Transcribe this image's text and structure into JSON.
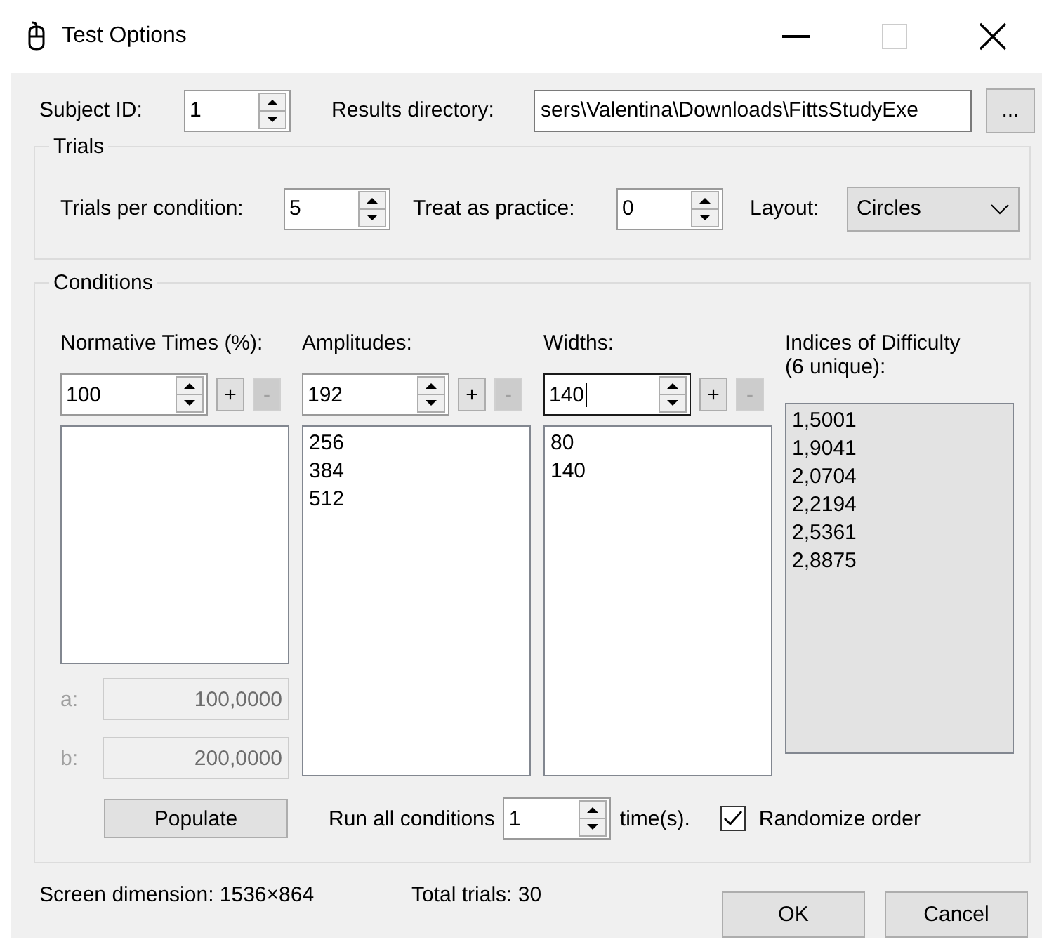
{
  "window": {
    "title": "Test Options"
  },
  "subject_id": {
    "label": "Subject ID:",
    "value": "1"
  },
  "results_directory": {
    "label": "Results directory:",
    "value": "sers\\Valentina\\Downloads\\FittsStudyExe"
  },
  "browse_button": {
    "label": "..."
  },
  "trials": {
    "title": "Trials",
    "trials_per_condition": {
      "label": "Trials per condition:",
      "value": "5"
    },
    "treat_as_practice": {
      "label": "Treat as practice:",
      "value": "0"
    },
    "layout": {
      "label": "Layout:",
      "value": "Circles"
    }
  },
  "conditions": {
    "title": "Conditions",
    "columns": [
      {
        "header": "Normative Times (%):",
        "value": "100",
        "focused": false,
        "add": "+",
        "remove": {
          "label": "-",
          "disabled": true
        }
      },
      {
        "header": "Amplitudes:",
        "value": "192",
        "focused": false,
        "add": "+",
        "remove": {
          "label": "-",
          "disabled": true
        },
        "items": [
          "256",
          "384",
          "512"
        ]
      },
      {
        "header": "Widths:",
        "value": "140",
        "focused": true,
        "add": "+",
        "remove": {
          "label": "-",
          "disabled": true
        },
        "items": [
          "80",
          "140"
        ]
      }
    ],
    "indices": {
      "header_lines": [
        "Indices of Difficulty",
        "(6 unique):"
      ],
      "items": [
        "1,5001",
        "1,9041",
        "2,0704",
        "2,2194",
        "2,5361",
        "2,8875"
      ]
    },
    "params": [
      {
        "label": "a:",
        "value": "100,0000",
        "disabled": true
      },
      {
        "label": "b:",
        "value": "200,0000",
        "disabled": true
      }
    ],
    "populate_button": "Populate",
    "run_all": {
      "label": "Run all conditions",
      "value": "1",
      "suffix": "time(s)."
    },
    "randomize": {
      "label": "Randomize order",
      "checked": true
    }
  },
  "status": {
    "screen_dimension": "Screen dimension: 1536×864",
    "total_trials": "Total trials: 30"
  },
  "buttons": [
    "OK",
    "Cancel"
  ]
}
